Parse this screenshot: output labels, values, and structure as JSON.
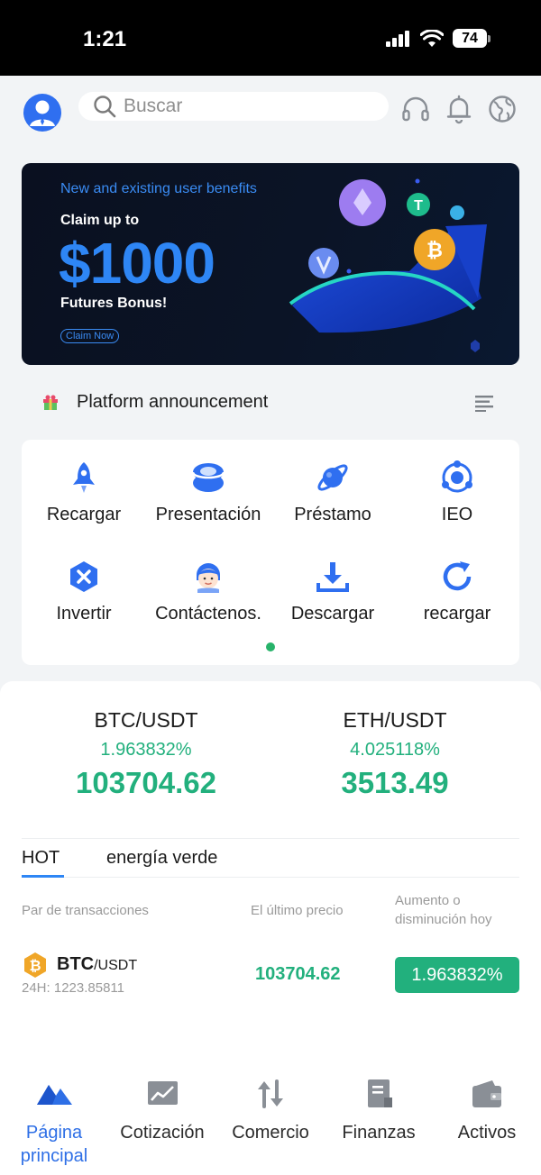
{
  "status_bar": {
    "time": "1:21",
    "battery": "74"
  },
  "header": {
    "search_placeholder": "Buscar"
  },
  "banner": {
    "subtitle": "New and existing user benefits",
    "claim": "Claim up to",
    "amount": "$1000",
    "bonus": "Futures Bonus!",
    "button": "Claim Now"
  },
  "announcement": {
    "label": "Platform announcement"
  },
  "quick_menu": [
    {
      "label": "Recargar",
      "icon": "rocket-icon"
    },
    {
      "label": "Presentación",
      "icon": "layers-icon"
    },
    {
      "label": "Préstamo",
      "icon": "planet-icon"
    },
    {
      "label": "IEO",
      "icon": "atom-icon"
    },
    {
      "label": "Invertir",
      "icon": "invest-icon"
    },
    {
      "label": "Contáctenos.",
      "icon": "support-agent-icon"
    },
    {
      "label": "Descargar",
      "icon": "download-icon"
    },
    {
      "label": "recargar",
      "icon": "refresh-icon"
    }
  ],
  "tickers": [
    {
      "pair": "BTC/USDT",
      "change": "1.963832%",
      "price": "103704.62"
    },
    {
      "pair": "ETH/USDT",
      "change": "4.025118%",
      "price": "3513.49"
    }
  ],
  "market_tabs": [
    "HOT",
    "energía verde"
  ],
  "table": {
    "headers": [
      "Par de transacciones",
      "El último precio",
      "Aumento o disminución hoy"
    ],
    "rows": [
      {
        "base": "BTC",
        "quote": "/USDT",
        "volume": "24H: 1223.85811",
        "price": "103704.62",
        "change": "1.963832%"
      }
    ]
  },
  "tabbar": [
    {
      "label": "Página principal",
      "icon": "home-mountain-icon",
      "active": true
    },
    {
      "label": "Cotización",
      "icon": "chart-icon"
    },
    {
      "label": "Comercio",
      "icon": "transfer-arrows-icon"
    },
    {
      "label": "Finanzas",
      "icon": "document-icon"
    },
    {
      "label": "Activos",
      "icon": "wallet-icon"
    }
  ],
  "colors": {
    "accent": "#2e6fe6",
    "up": "#22b07d",
    "banner_bg": "#0a1020"
  }
}
